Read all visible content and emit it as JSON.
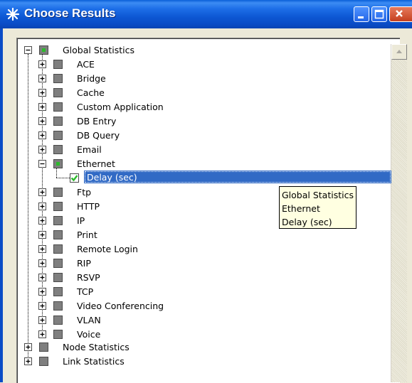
{
  "window": {
    "title": "Choose Results",
    "title_icon": "star-burst-icon",
    "buttons": [
      "minimize-icon",
      "maximize-icon",
      "close-icon"
    ]
  },
  "tree": {
    "root": {
      "label": "Global Statistics",
      "state": "partial",
      "expanded": true
    },
    "global_children": [
      {
        "label": "ACE",
        "state": "unchecked",
        "expanded": false
      },
      {
        "label": "Bridge",
        "state": "unchecked",
        "expanded": false
      },
      {
        "label": "Cache",
        "state": "unchecked",
        "expanded": false
      },
      {
        "label": "Custom Application",
        "state": "unchecked",
        "expanded": false
      },
      {
        "label": "DB Entry",
        "state": "unchecked",
        "expanded": false
      },
      {
        "label": "DB Query",
        "state": "unchecked",
        "expanded": false
      },
      {
        "label": "Email",
        "state": "unchecked",
        "expanded": false
      },
      {
        "label": "Ethernet",
        "state": "partial",
        "expanded": true
      },
      {
        "label": "Ftp",
        "state": "unchecked",
        "expanded": false
      },
      {
        "label": "HTTP",
        "state": "unchecked",
        "expanded": false
      },
      {
        "label": "IP",
        "state": "unchecked",
        "expanded": false
      },
      {
        "label": "Print",
        "state": "unchecked",
        "expanded": false
      },
      {
        "label": "Remote Login",
        "state": "unchecked",
        "expanded": false
      },
      {
        "label": "RIP",
        "state": "unchecked",
        "expanded": false
      },
      {
        "label": "RSVP",
        "state": "unchecked",
        "expanded": false
      },
      {
        "label": "TCP",
        "state": "unchecked",
        "expanded": false
      },
      {
        "label": "Video Conferencing",
        "state": "unchecked",
        "expanded": false
      },
      {
        "label": "VLAN",
        "state": "unchecked",
        "expanded": false
      },
      {
        "label": "Voice",
        "state": "unchecked",
        "expanded": false
      }
    ],
    "ethernet_child": {
      "label": "Delay (sec)",
      "state": "checked",
      "selected": true
    },
    "other_roots": [
      {
        "label": "Node Statistics",
        "state": "unchecked",
        "expanded": false
      },
      {
        "label": "Link Statistics",
        "state": "unchecked",
        "expanded": false
      }
    ]
  },
  "tooltip": {
    "lines": [
      "Global Statistics",
      "Ethernet",
      "Delay (sec)"
    ]
  },
  "colors": {
    "titlebar": "#0a4cc6",
    "selection": "#316ac5",
    "check_green": "#2cba2c",
    "tooltip_bg": "#ffffe1",
    "checkbox_gray": "#7f7f7f"
  }
}
